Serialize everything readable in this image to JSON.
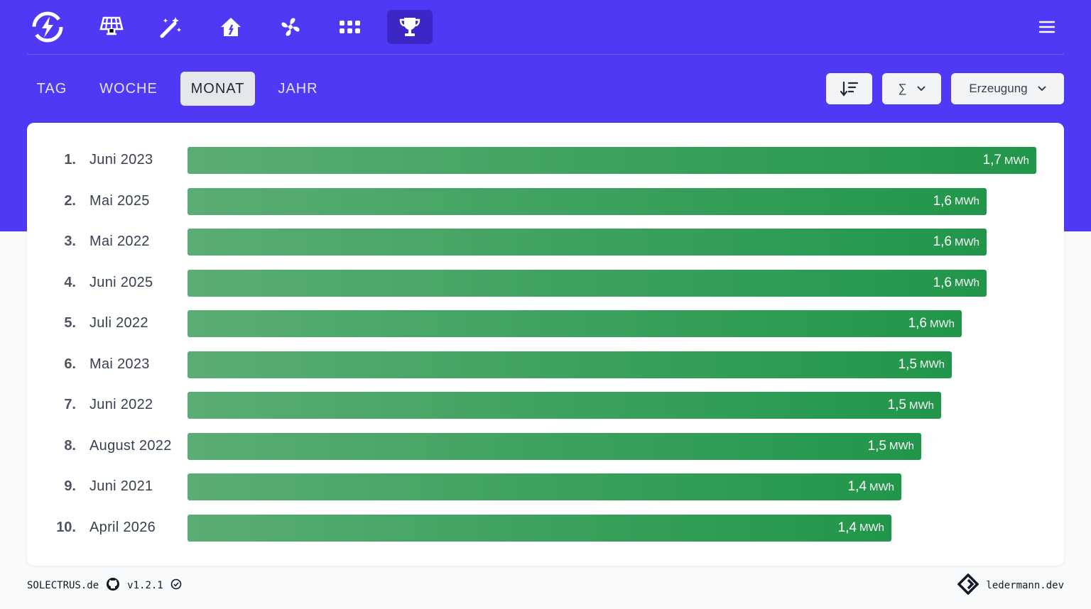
{
  "nav": {
    "icons": [
      "solectrus-logo-icon",
      "solar-panel-icon",
      "magic-wand-icon",
      "house-icon",
      "fan-icon",
      "grid-dots-icon",
      "trophy-icon"
    ],
    "active": "trophy-icon",
    "menu_icon": "hamburger-menu-icon"
  },
  "tabs": [
    {
      "label": "TAG",
      "active": false
    },
    {
      "label": "WOCHE",
      "active": false
    },
    {
      "label": "MONAT",
      "active": true
    },
    {
      "label": "JAHR",
      "active": false
    }
  ],
  "controls": {
    "sort_icon": "sort-descending-icon",
    "aggregation_label": "∑",
    "field_label": "Erzeugung"
  },
  "ranking": {
    "max": 1.7,
    "unit": "MWh",
    "rows": [
      {
        "rank": "1.",
        "month": "Juni 2023",
        "value": 1.7,
        "value_label": "1,7"
      },
      {
        "rank": "2.",
        "month": "Mai 2025",
        "value": 1.6,
        "value_label": "1,6"
      },
      {
        "rank": "3.",
        "month": "Mai 2022",
        "value": 1.6,
        "value_label": "1,6"
      },
      {
        "rank": "4.",
        "month": "Juni 2025",
        "value": 1.6,
        "value_label": "1,6"
      },
      {
        "rank": "5.",
        "month": "Juli 2022",
        "value": 1.55,
        "value_label": "1,6"
      },
      {
        "rank": "6.",
        "month": "Mai 2023",
        "value": 1.53,
        "value_label": "1,5"
      },
      {
        "rank": "7.",
        "month": "Juni 2022",
        "value": 1.51,
        "value_label": "1,5"
      },
      {
        "rank": "8.",
        "month": "August 2022",
        "value": 1.47,
        "value_label": "1,5"
      },
      {
        "rank": "9.",
        "month": "Juni 2021",
        "value": 1.43,
        "value_label": "1,4"
      },
      {
        "rank": "10.",
        "month": "April 2026",
        "value": 1.41,
        "value_label": "1,4"
      }
    ]
  },
  "footer": {
    "brand": "SOLECTRUS.de",
    "github_icon": "github-icon",
    "version": "v1.2.1",
    "check_icon": "check-circle-icon",
    "author": "ledermann.dev",
    "author_logo": "ledermann-logo-icon"
  }
}
